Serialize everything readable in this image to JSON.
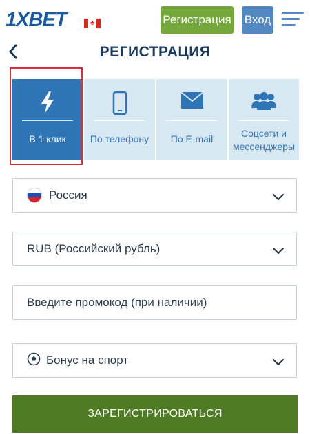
{
  "header": {
    "logo": "1XBET",
    "register_label": "Регистрация",
    "login_label": "Вход"
  },
  "title": "РЕГИСТРАЦИЯ",
  "tabs": [
    {
      "label": "В 1 клик",
      "icon": "lightning-icon",
      "active": true
    },
    {
      "label": "По телефону",
      "icon": "phone-icon",
      "active": false
    },
    {
      "label": "По E-mail",
      "icon": "envelope-icon",
      "active": false
    },
    {
      "label": "Соцсети и мессенджеры",
      "icon": "users-icon",
      "active": false
    }
  ],
  "form": {
    "country": "Россия",
    "currency": "RUB (Российский рубль)",
    "promo_placeholder": "Введите промокод (при наличии)",
    "bonus": "Бонус на спорт",
    "submit_label": "ЗАРЕГИСТРИРОВАТЬСЯ"
  },
  "colors": {
    "brand": "#1a5aa0",
    "register_green": "#74a83a",
    "login_blue": "#5287c1",
    "tab_active": "#2f74b5",
    "tab_inactive": "#d8e8f3",
    "submit_green": "#4f7a24",
    "highlight_red": "#d93036"
  }
}
